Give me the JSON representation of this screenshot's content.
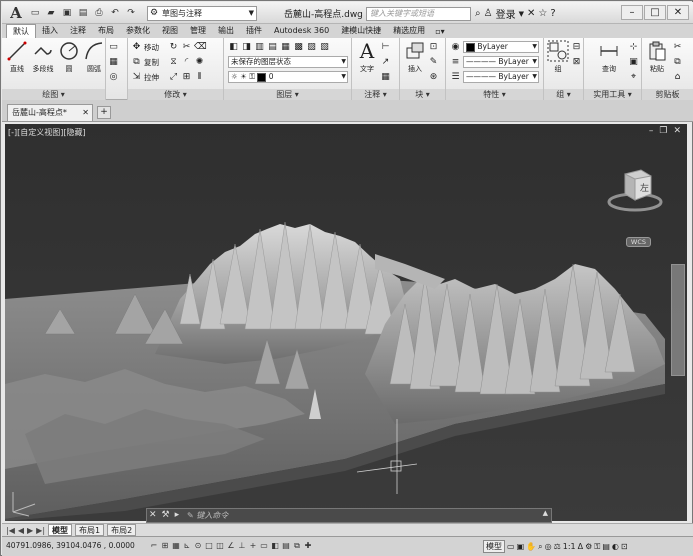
{
  "app": {
    "logo": "A",
    "document_title": "岳麓山-高程点.dwg"
  },
  "qat": {
    "workspace": "草图与注释",
    "icons": [
      "new-icon",
      "open-icon",
      "save-icon",
      "save-as-icon",
      "print-icon",
      "undo-icon",
      "redo-icon"
    ]
  },
  "search": {
    "placeholder": "键入关键字或短语"
  },
  "user": {
    "login_label": "登录"
  },
  "ribbon_tabs": [
    "默认",
    "插入",
    "注释",
    "布局",
    "参数化",
    "视图",
    "管理",
    "输出",
    "插件",
    "Autodesk 360",
    "建模山快捷",
    "精选应用"
  ],
  "panels": {
    "draw": {
      "label": "绘图",
      "tools": [
        "直线",
        "多段线",
        "圆",
        "圆弧"
      ]
    },
    "modify": {
      "label": "修改",
      "tools": [
        "移动",
        "复制",
        "拉伸"
      ]
    },
    "layers": {
      "label": "图层",
      "layer_state": "未保存的图层状态",
      "current_layer": "0"
    },
    "annotation": {
      "label": "注释",
      "text_tool": "文字"
    },
    "block": {
      "label": "块",
      "insert_tool": "插入"
    },
    "properties": {
      "label": "特性",
      "color": "ByLayer",
      "linetype": "ByLayer",
      "lineweight": "ByLayer"
    },
    "groups": {
      "label": "组",
      "group_tool": "组"
    },
    "utilities": {
      "label": "实用工具",
      "measure_tool": "查询"
    },
    "clipboard": {
      "label": "剪贴板",
      "paste_tool": "粘贴"
    }
  },
  "doc_tab": {
    "label": "岳麓山-高程点*"
  },
  "viewport": {
    "label": "[-][自定义视图][隐藏]",
    "wcs": "WCS",
    "viewcube_face": "左"
  },
  "command": {
    "prompt": "键入命令"
  },
  "layout_tabs": [
    "模型",
    "布局1",
    "布局2"
  ],
  "status": {
    "coords": "40791.0986, 39104.0476 , 0.0000",
    "model_label": "模型",
    "scale": "1:1"
  }
}
